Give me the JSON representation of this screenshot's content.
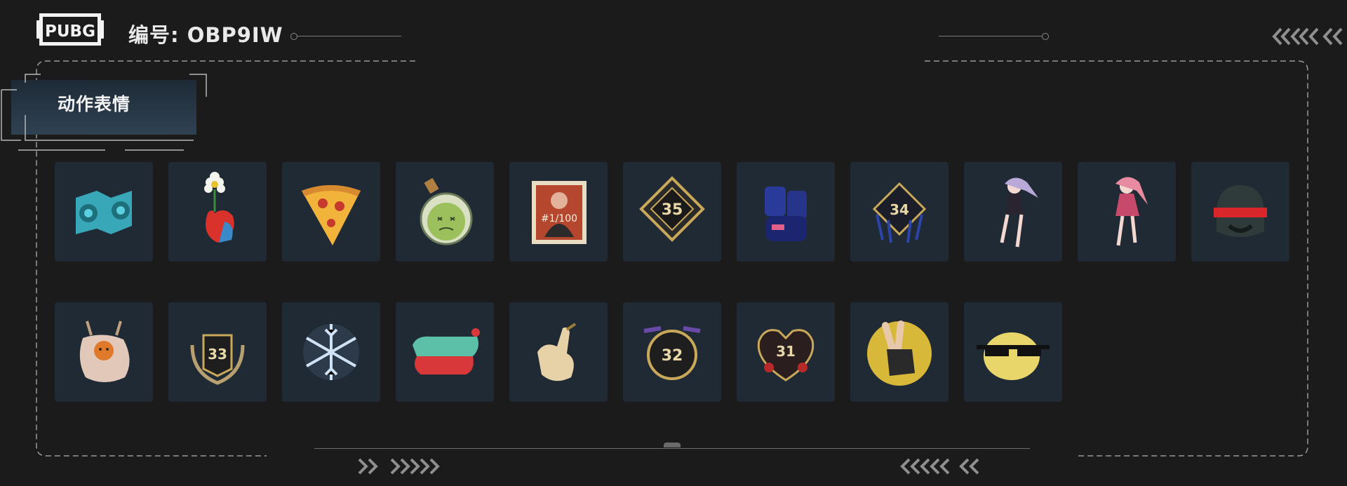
{
  "header": {
    "logo_text": "PUBG",
    "code_label": "编号: OBP9IW"
  },
  "tab": {
    "label": "动作表情"
  },
  "emotes": [
    {
      "name": "teal-speakers-icon"
    },
    {
      "name": "flower-heart-icon"
    },
    {
      "name": "pizza-slice-icon"
    },
    {
      "name": "potion-bottle-icon"
    },
    {
      "name": "portrait-poster-icon"
    },
    {
      "name": "season-35-badge-icon"
    },
    {
      "name": "graffiti-character-icon"
    },
    {
      "name": "season-34-badge-icon"
    },
    {
      "name": "anime-girl-purple-icon"
    },
    {
      "name": "anime-girl-pink-icon"
    },
    {
      "name": "helmet-visor-icon"
    },
    {
      "name": "fried-egg-creature-icon"
    },
    {
      "name": "season-33-badge-icon"
    },
    {
      "name": "snowflake-icon"
    },
    {
      "name": "graffiti-text-icon"
    },
    {
      "name": "finger-heart-hand-icon"
    },
    {
      "name": "season-32-badge-icon"
    },
    {
      "name": "season-31-heart-badge-icon"
    },
    {
      "name": "peace-sign-hand-icon"
    },
    {
      "name": "lemon-sunglasses-icon"
    }
  ],
  "colors": {
    "background": "#1b1b1c",
    "tile": "#202a35",
    "frame_dash": "#9a9a9a",
    "chevron": "#8f8f8f"
  }
}
